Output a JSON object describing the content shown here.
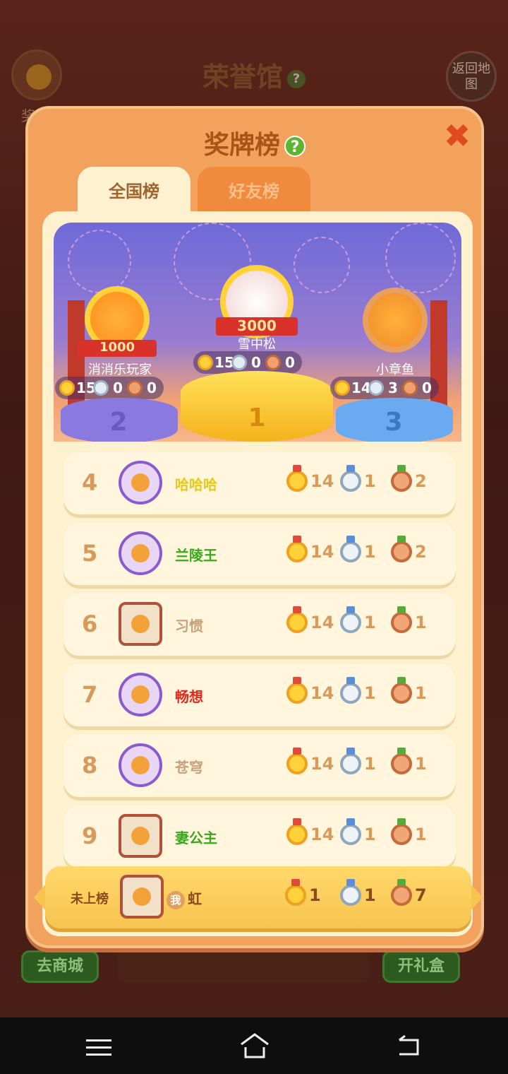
{
  "background": {
    "title": "荣誉馆",
    "help": "?",
    "left_label": "奖",
    "back_button": "返回地图",
    "shop_button": "去商城",
    "giftbox_button": "开礼盒"
  },
  "modal": {
    "title": "奖牌榜",
    "help": "?",
    "close": "✖",
    "tabs": [
      {
        "label": "全国榜",
        "active": true
      },
      {
        "label": "好友榜",
        "active": false
      }
    ]
  },
  "podium": {
    "first": {
      "name": "雪中松",
      "badge": "3000",
      "gold": "15",
      "silver": "0",
      "bronze": "0",
      "rank": "1"
    },
    "second": {
      "name": "消消乐玩家",
      "badge": "1000",
      "gold": "15",
      "silver": "0",
      "bronze": "0",
      "rank": "2"
    },
    "third": {
      "name": "小章鱼",
      "gold": "14",
      "silver": "3",
      "bronze": "0",
      "rank": "3"
    }
  },
  "rows": [
    {
      "rank": "4",
      "name": "哈哈哈",
      "color": "#e8c81a",
      "gold": "14",
      "silver": "1",
      "bronze": "2"
    },
    {
      "rank": "5",
      "name": "兰陵王",
      "color": "#3aa81a",
      "gold": "14",
      "silver": "1",
      "bronze": "2"
    },
    {
      "rank": "6",
      "name": "习惯",
      "color": "#c8a07a",
      "gold": "14",
      "silver": "1",
      "bronze": "1"
    },
    {
      "rank": "7",
      "name": "畅想",
      "color": "#e02a1a",
      "gold": "14",
      "silver": "1",
      "bronze": "1"
    },
    {
      "rank": "8",
      "name": "苍穹",
      "color": "#c8a07a",
      "gold": "14",
      "silver": "1",
      "bronze": "1"
    },
    {
      "rank": "9",
      "name": "妻公主",
      "color": "#3aa81a",
      "gold": "14",
      "silver": "1",
      "bronze": "1"
    }
  ],
  "me": {
    "rank": "未上榜",
    "badge": "我",
    "name": "虹",
    "gold": "1",
    "silver": "1",
    "bronze": "7"
  }
}
